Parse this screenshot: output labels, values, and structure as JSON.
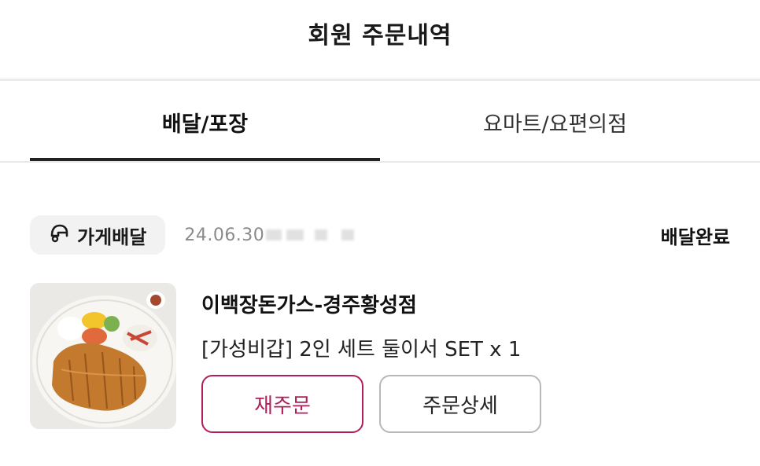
{
  "header": {
    "title": "회원 주문내역"
  },
  "tabs": [
    {
      "label": "배달/포장",
      "active": true
    },
    {
      "label": "요마트/요편의점",
      "active": false
    }
  ],
  "order": {
    "type_label": "가게배달",
    "type_icon": "delivery-rider-icon",
    "date": "24.06.30",
    "status": "배달완료",
    "store_name": "이백장돈가스-경주황성점",
    "menu_summary": "[가성비갑] 2인 세트 둘이서 SET x 1",
    "reorder_label": "재주문",
    "detail_label": "주문상세"
  },
  "colors": {
    "accent": "#b01f5a",
    "tab_indicator": "#222222",
    "badge_bg": "#f2f2f2"
  }
}
